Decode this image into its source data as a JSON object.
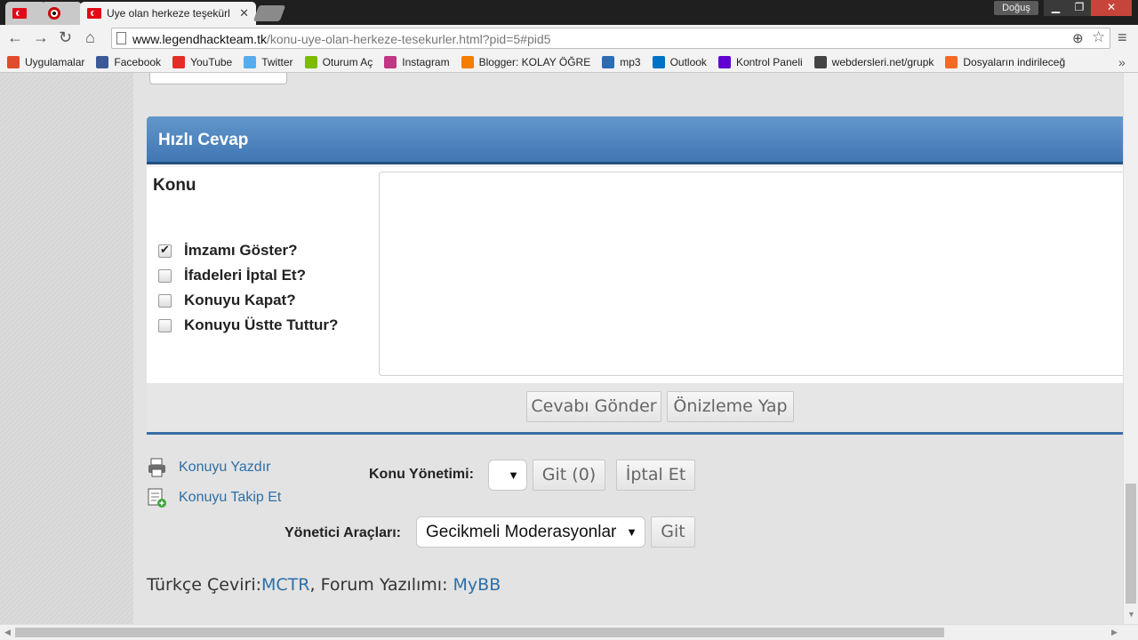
{
  "browser": {
    "tabs": [
      {
        "title": "",
        "icon": "turkish-flag-icon"
      },
      {
        "title": "",
        "icon": "target-icon"
      },
      {
        "title": "Uye olan herkeze teşekürl",
        "icon": "turkish-flag-icon",
        "active": true
      }
    ],
    "user_badge": "Doğuş",
    "url_host": "www.legendhackteam.tk",
    "url_path": "/konu-uye-olan-herkeze-tesekurler.html?pid=5#pid5",
    "bookmarks": [
      {
        "label": "Uygulamalar",
        "icon": "apps-grid-icon",
        "color": "#e04b2b"
      },
      {
        "label": "Facebook",
        "icon": "facebook-icon",
        "color": "#3b5998"
      },
      {
        "label": "YouTube",
        "icon": "youtube-icon",
        "color": "#e52d27"
      },
      {
        "label": "Twitter",
        "icon": "twitter-icon",
        "color": "#55acee"
      },
      {
        "label": "Oturum Aç",
        "icon": "microsoft-icon",
        "color": "#7cbb00"
      },
      {
        "label": "Instagram",
        "icon": "instagram-icon",
        "color": "#c13584"
      },
      {
        "label": "Blogger: KOLAY ÖĞRE",
        "icon": "blogger-icon",
        "color": "#f57d00"
      },
      {
        "label": "mp3",
        "icon": "mp3-icon",
        "color": "#2b6db3"
      },
      {
        "label": "Outlook",
        "icon": "outlook-icon",
        "color": "#0072c6"
      },
      {
        "label": "Kontrol Paneli",
        "icon": "yahoo-icon",
        "color": "#6001d2"
      },
      {
        "label": "webdersleri.net/grupk",
        "icon": "flag-bookmark-icon",
        "color": "#444444"
      },
      {
        "label": "Dosyaların indirileceğ",
        "icon": "download-icon",
        "color": "#f46a25"
      }
    ]
  },
  "quick_reply": {
    "title": "Hızlı Cevap",
    "subject_label": "Konu",
    "options": [
      {
        "label": "İmzamı Göster?",
        "checked": true
      },
      {
        "label": "İfadeleri İptal Et?",
        "checked": false
      },
      {
        "label": "Konuyu Kapat?",
        "checked": false
      },
      {
        "label": "Konuyu Üstte Tuttur?",
        "checked": false
      }
    ],
    "message_value": "",
    "submit_label": "Cevabı Gönder",
    "preview_label": "Önizleme Yap"
  },
  "thread_tools": {
    "print_label": "Konuyu Yazdır",
    "subscribe_label": "Konuyu Takip Et",
    "moderation_label": "Konu Yönetimi:",
    "moderation_selected": "",
    "go_count_label": "Git (0)",
    "cancel_label": "İptal Et",
    "admin_tools_label": "Yönetici Araçları:",
    "admin_tools_selected": "Gecikmeli Moderasyonlar",
    "go_label": "Git"
  },
  "footer": {
    "translation_prefix": "Türkçe Çeviri:",
    "translation_link": "MCTR",
    "software_prefix": ", Forum Yazılımı: ",
    "software_link": "MyBB"
  },
  "accent_color": "#3f77b5",
  "link_color": "#2c6fa8"
}
